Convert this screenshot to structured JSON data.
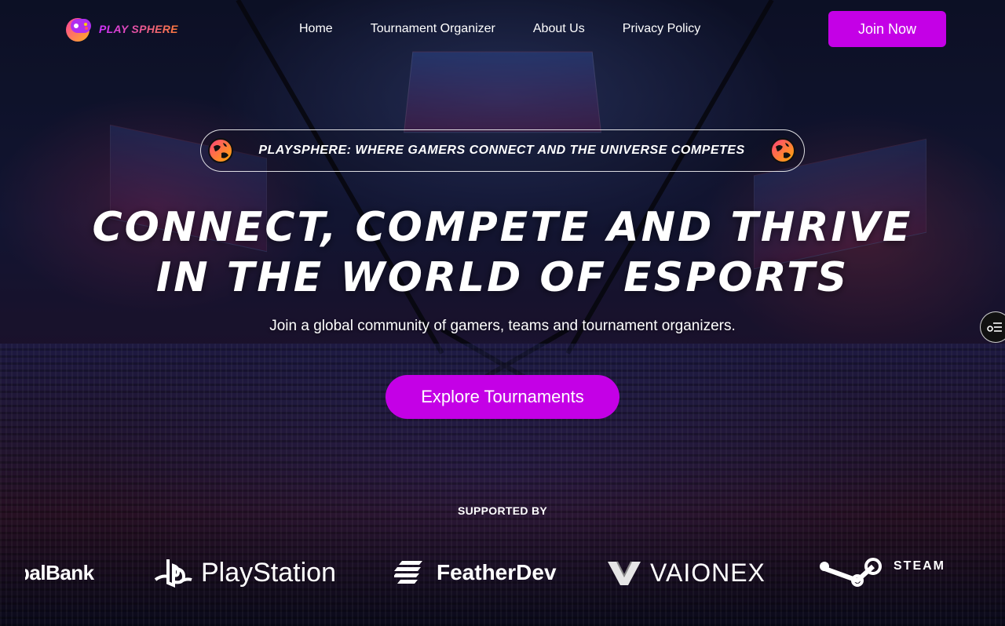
{
  "brand": {
    "name": "PLAY SPHERE"
  },
  "nav": {
    "links": [
      "Home",
      "Tournament Organizer",
      "About Us",
      "Privacy Policy"
    ],
    "join_label": "Join Now"
  },
  "hero": {
    "tagline": "PlaySphere: Where Gamers Connect and the Universe Competes",
    "title_line1": "Connect, Compete and Thrive",
    "title_line2": "in the World of Esports",
    "subtitle": "Join a global community of gamers, teams and tournament organizers.",
    "cta_label": "Explore Tournaments"
  },
  "supporters": {
    "label": "SUPPORTED BY",
    "logos": [
      {
        "name": "balBank",
        "icon": "bank-logo"
      },
      {
        "name": "PlayStation",
        "icon": "playstation-icon"
      },
      {
        "name": "FeatherDev",
        "icon": "featherdev-icon"
      },
      {
        "name": "VAIONEX",
        "icon": "vaionex-icon"
      },
      {
        "name": "STEAM",
        "icon": "steam-icon"
      }
    ]
  },
  "colors": {
    "accent": "#c400e6",
    "logo_gradient_start": "#d030ff",
    "logo_gradient_end": "#ff7a3a"
  }
}
